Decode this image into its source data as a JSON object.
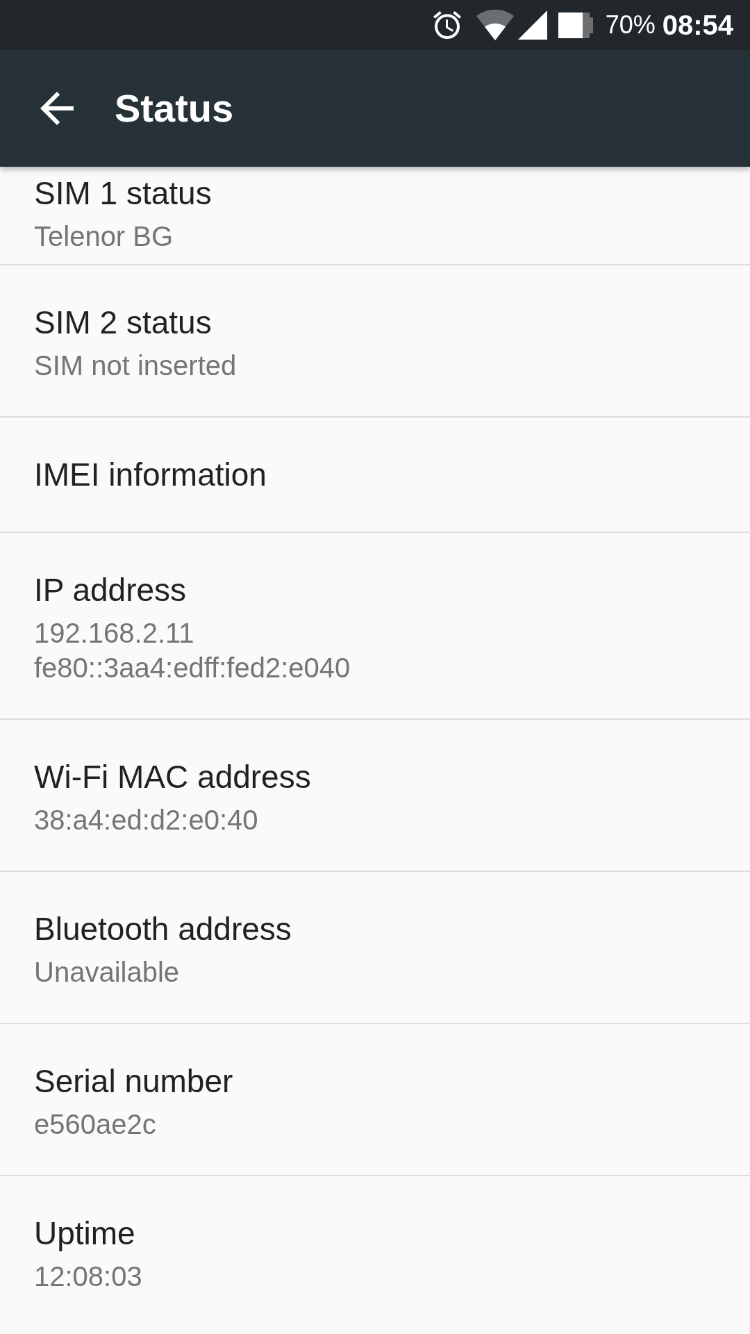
{
  "status_bar": {
    "battery_percent": "70%",
    "time": "08:54"
  },
  "toolbar": {
    "title": "Status"
  },
  "items": [
    {
      "title": "SIM 1 status",
      "summary_lines": [
        "Telenor BG"
      ]
    },
    {
      "title": "SIM 2 status",
      "summary_lines": [
        "SIM not inserted"
      ]
    },
    {
      "title": "IMEI information"
    },
    {
      "title": "IP address",
      "summary_lines": [
        "192.168.2.11",
        "fe80::3aa4:edff:fed2:e040"
      ]
    },
    {
      "title": "Wi-Fi MAC address",
      "summary_lines": [
        "38:a4:ed:d2:e0:40"
      ]
    },
    {
      "title": "Bluetooth address",
      "summary_lines": [
        "Unavailable"
      ]
    },
    {
      "title": "Serial number",
      "summary_lines": [
        "e560ae2c"
      ]
    },
    {
      "title": "Uptime",
      "summary_lines": [
        "12:08:03"
      ]
    }
  ]
}
